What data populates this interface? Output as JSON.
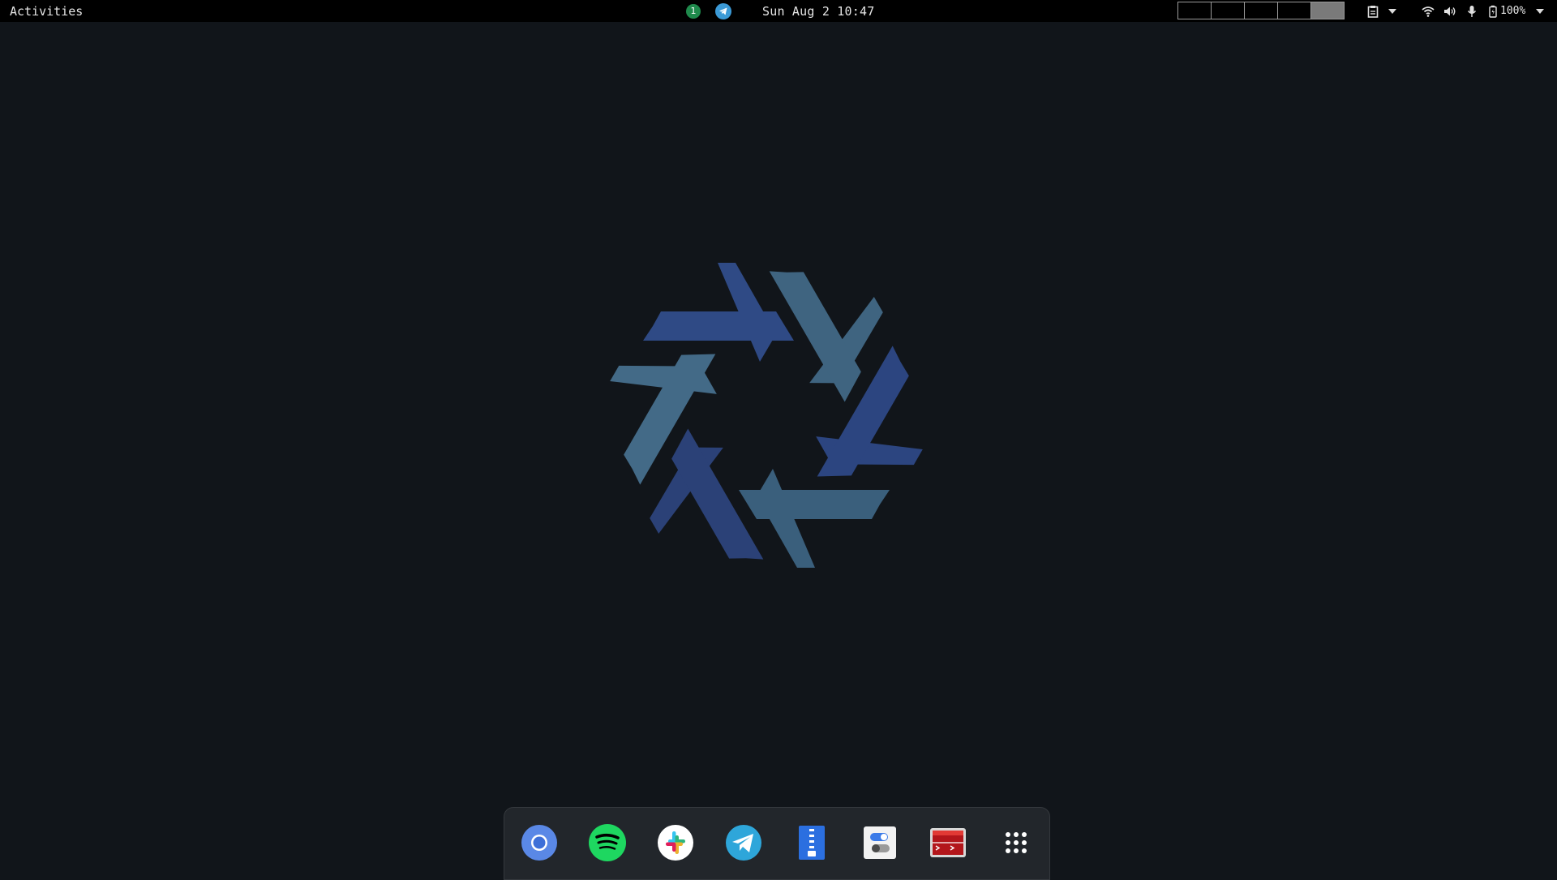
{
  "topbar": {
    "activities_label": "Activities",
    "clock": "Sun Aug 2 10:47",
    "notification_count": "1",
    "battery_percent": "100%",
    "workspaces": [
      {
        "active": false
      },
      {
        "active": false
      },
      {
        "active": false
      },
      {
        "active": false
      },
      {
        "active": true
      }
    ],
    "icons": {
      "notification": "notification-badge-icon",
      "telegram": "telegram-tray-icon",
      "clipboard": "clipboard-icon",
      "wifi": "wifi-icon",
      "volume": "volume-icon",
      "microphone": "microphone-icon",
      "battery": "battery-icon"
    }
  },
  "wallpaper": {
    "logo": "nixos-snowflake-logo",
    "colors": {
      "background": "#11151a",
      "dark_blue": "#2f4a85",
      "teal_blue": "#3f6480"
    }
  },
  "dock": {
    "apps": [
      {
        "name": "chromium-icon"
      },
      {
        "name": "spotify-icon"
      },
      {
        "name": "slack-icon"
      },
      {
        "name": "telegram-icon"
      },
      {
        "name": "file-archiver-icon"
      },
      {
        "name": "settings-toggle-icon"
      },
      {
        "name": "terminal-icon"
      },
      {
        "name": "show-applications-icon"
      }
    ]
  }
}
